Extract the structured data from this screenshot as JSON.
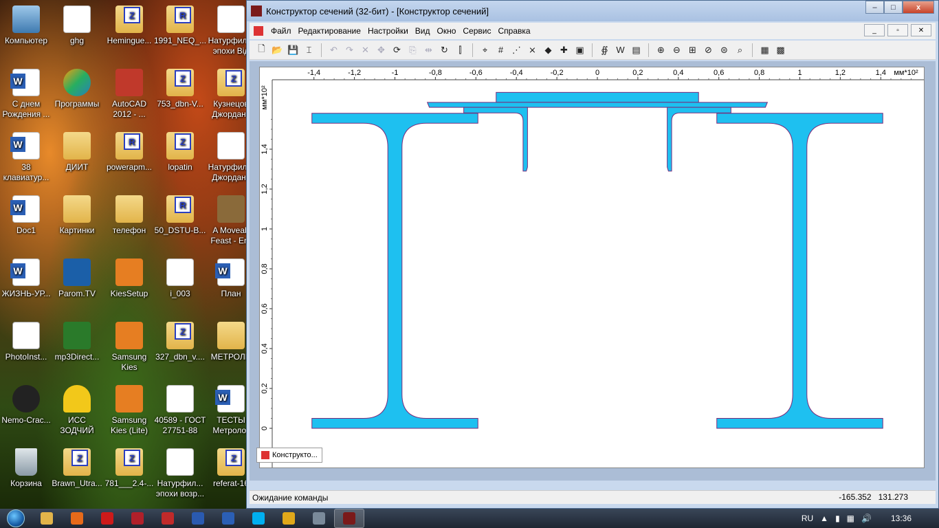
{
  "desktop": {
    "icons": [
      {
        "label": "Компьютер",
        "icon": "computer-icon",
        "type": "computer",
        "col": 0,
        "row": 0
      },
      {
        "label": "ghg",
        "icon": "document-icon",
        "type": "doc",
        "col": 1,
        "row": 0
      },
      {
        "label": "Hemingue...",
        "icon": "archive-icon",
        "type": "folder-z",
        "col": 2,
        "row": 0
      },
      {
        "label": "1991_NEQ_...",
        "icon": "archive-icon",
        "type": "folder-r",
        "col": 3,
        "row": 0
      },
      {
        "label": "Натурфил... эпохи Від",
        "icon": "document-icon",
        "type": "doc",
        "col": 4,
        "row": 0
      },
      {
        "label": "С днем Рождения ...",
        "icon": "word-doc-icon",
        "type": "word",
        "col": 0,
        "row": 1
      },
      {
        "label": "Программы",
        "icon": "msn-icon",
        "type": "msn",
        "col": 1,
        "row": 1
      },
      {
        "label": "AutoCAD 2012 - ...",
        "icon": "autocad-icon",
        "type": "red",
        "col": 2,
        "row": 1
      },
      {
        "label": "753_dbn-V...",
        "icon": "archive-icon",
        "type": "folder-z",
        "col": 3,
        "row": 1
      },
      {
        "label": "Кузнецов Джорданс",
        "icon": "archive-icon",
        "type": "folder-z",
        "col": 4,
        "row": 1
      },
      {
        "label": "38 клавиатур...",
        "icon": "word-doc-icon",
        "type": "word",
        "col": 0,
        "row": 2
      },
      {
        "label": "ДИИТ",
        "icon": "folder-icon",
        "type": "folder",
        "col": 1,
        "row": 2
      },
      {
        "label": "powerapm...",
        "icon": "archive-icon",
        "type": "folder-r",
        "col": 2,
        "row": 2
      },
      {
        "label": "lopatin",
        "icon": "archive-icon",
        "type": "folder-z",
        "col": 3,
        "row": 2
      },
      {
        "label": "Натурфил... Джорданс",
        "icon": "document-icon",
        "type": "doc",
        "col": 4,
        "row": 2
      },
      {
        "label": "Doc1",
        "icon": "word-doc-icon",
        "type": "word",
        "col": 0,
        "row": 3
      },
      {
        "label": "Картинки",
        "icon": "folder-icon",
        "type": "folder",
        "col": 1,
        "row": 3
      },
      {
        "label": "телефон",
        "icon": "folder-icon",
        "type": "folder",
        "col": 2,
        "row": 3
      },
      {
        "label": "50_DSTU-B...",
        "icon": "archive-icon",
        "type": "folder-r",
        "col": 3,
        "row": 3
      },
      {
        "label": "A Moveab Feast - Ern",
        "icon": "book-icon",
        "type": "book",
        "col": 4,
        "row": 3
      },
      {
        "label": "ЖИЗНЬ-УР...",
        "icon": "word-doc-icon",
        "type": "word",
        "col": 0,
        "row": 4
      },
      {
        "label": "Parom.TV",
        "icon": "parom-tv-icon",
        "type": "tv",
        "col": 1,
        "row": 4
      },
      {
        "label": "KiesSetup",
        "icon": "kies-icon",
        "type": "orange",
        "col": 2,
        "row": 4
      },
      {
        "label": "i_003",
        "icon": "document-icon",
        "type": "doc",
        "col": 3,
        "row": 4
      },
      {
        "label": "План",
        "icon": "word-doc-icon",
        "type": "word",
        "col": 4,
        "row": 4
      },
      {
        "label": "PhotoInst...",
        "icon": "photo-icon",
        "type": "photo",
        "col": 0,
        "row": 5
      },
      {
        "label": "mp3Direct...",
        "icon": "mp3-cut-icon",
        "type": "green",
        "col": 1,
        "row": 5
      },
      {
        "label": "Samsung Kies",
        "icon": "kies-icon",
        "type": "orange",
        "col": 2,
        "row": 5
      },
      {
        "label": "327_dbn_v....",
        "icon": "archive-icon",
        "type": "folder-z",
        "col": 3,
        "row": 5
      },
      {
        "label": "МЕТРОЛИ",
        "icon": "folder-icon",
        "type": "folder",
        "col": 4,
        "row": 5
      },
      {
        "label": "Nemo-Crac...",
        "icon": "nemo-icon",
        "type": "nemo",
        "col": 0,
        "row": 6
      },
      {
        "label": "ИСС ЗОДЧИЙ",
        "icon": "hardhat-icon",
        "type": "hat",
        "col": 1,
        "row": 6
      },
      {
        "label": "Samsung Kies (Lite)",
        "icon": "kies-icon",
        "type": "orange",
        "col": 2,
        "row": 6
      },
      {
        "label": "40589 - ГОСТ 27751-88",
        "icon": "document-icon",
        "type": "doc",
        "col": 3,
        "row": 6
      },
      {
        "label": "ТЕСТЫ Метролог",
        "icon": "word-doc-icon",
        "type": "word",
        "col": 4,
        "row": 6
      },
      {
        "label": "Корзина",
        "icon": "recycle-bin-icon",
        "type": "bin",
        "col": 0,
        "row": 7
      },
      {
        "label": "Brawn_Utra...",
        "icon": "archive-icon",
        "type": "folder-z",
        "col": 1,
        "row": 7
      },
      {
        "label": "781___2.4-...",
        "icon": "archive-icon",
        "type": "folder-z",
        "col": 2,
        "row": 7
      },
      {
        "label": "Натурфил... эпохи возр...",
        "icon": "document-icon",
        "type": "doc",
        "col": 3,
        "row": 7
      },
      {
        "label": "referat-16",
        "icon": "archive-icon",
        "type": "folder-z",
        "col": 4,
        "row": 7
      }
    ]
  },
  "window": {
    "title": "Конструктор сечений (32-бит) - [Конструктор сечений]",
    "controls": {
      "minimize": "–",
      "maximize": "□",
      "close": "x"
    }
  },
  "menubar": {
    "items": [
      "Файл",
      "Редактирование",
      "Настройки",
      "Вид",
      "Окно",
      "Сервис",
      "Справка"
    ],
    "mdi": {
      "minimize": "_",
      "restore": "▫",
      "close": "✕"
    }
  },
  "toolbar": {
    "groups": [
      [
        {
          "name": "new-icon",
          "glyph": "🗋",
          "enabled": true
        },
        {
          "name": "open-icon",
          "glyph": "📂",
          "enabled": true
        },
        {
          "name": "save-icon",
          "glyph": "💾",
          "enabled": true
        },
        {
          "name": "properties-icon",
          "glyph": "⌶",
          "enabled": true
        }
      ],
      [
        {
          "name": "undo-icon",
          "glyph": "↶",
          "enabled": false
        },
        {
          "name": "redo-icon",
          "glyph": "↷",
          "enabled": false
        },
        {
          "name": "delete-icon",
          "glyph": "✕",
          "enabled": false
        },
        {
          "name": "move-icon",
          "glyph": "✥",
          "enabled": false
        },
        {
          "name": "rotate-icon",
          "glyph": "⟳",
          "enabled": true
        },
        {
          "name": "copy-icon",
          "glyph": "⎘",
          "enabled": false
        },
        {
          "name": "mirror-icon",
          "glyph": "⇹",
          "enabled": false
        },
        {
          "name": "refresh-icon",
          "glyph": "↻",
          "enabled": true
        },
        {
          "name": "section-icon",
          "glyph": "⫿",
          "enabled": true
        }
      ],
      [
        {
          "name": "snap-icon",
          "glyph": "⌖",
          "enabled": true
        },
        {
          "name": "grid-icon",
          "glyph": "#",
          "enabled": true
        },
        {
          "name": "nodes-icon",
          "glyph": "⋰",
          "enabled": true
        },
        {
          "name": "cross-icon",
          "glyph": "⨯",
          "enabled": true
        },
        {
          "name": "point-icon",
          "glyph": "◆",
          "enabled": true
        },
        {
          "name": "plus-icon",
          "glyph": "✚",
          "enabled": true
        },
        {
          "name": "calc-icon",
          "glyph": "▣",
          "enabled": true
        }
      ],
      [
        {
          "name": "stress-icon",
          "glyph": "∯",
          "enabled": true
        },
        {
          "name": "w-icon",
          "glyph": "W",
          "enabled": true
        },
        {
          "name": "palette-icon",
          "glyph": "▤",
          "enabled": true
        }
      ],
      [
        {
          "name": "zoom-in-icon",
          "glyph": "⊕",
          "enabled": true
        },
        {
          "name": "zoom-out-icon",
          "glyph": "⊖",
          "enabled": true
        },
        {
          "name": "zoom-window-icon",
          "glyph": "⊞",
          "enabled": true
        },
        {
          "name": "zoom-prev-icon",
          "glyph": "⊘",
          "enabled": true
        },
        {
          "name": "zoom-fit-icon",
          "glyph": "⊜",
          "enabled": true
        },
        {
          "name": "zoom-all-icon",
          "glyph": "⌕",
          "enabled": true
        }
      ],
      [
        {
          "name": "layout-icon",
          "glyph": "▦",
          "enabled": true
        },
        {
          "name": "report-icon",
          "glyph": "▩",
          "enabled": true
        }
      ]
    ]
  },
  "drawing": {
    "unit_label": "мм*10²",
    "x_ticks": [
      "-1,4",
      "-1,2",
      "-1",
      "-0,8",
      "-0,6",
      "-0,4",
      "-0,2",
      "0",
      "0,2",
      "0,4",
      "0,6",
      "0,8",
      "1",
      "1,2",
      "1,4"
    ],
    "y_ticks": [
      "0",
      "0,2",
      "0,4",
      "0,6",
      "0,8",
      "1",
      "1,2",
      "1,4"
    ],
    "x_range": [
      -1.4,
      1.4
    ],
    "y_range": [
      0,
      1.6
    ],
    "fill_color": "#1ec0f0",
    "stroke_color": "#7a2a7a"
  },
  "tab": {
    "label": "Конструкто..."
  },
  "statusbar": {
    "message": "Ожидание команды",
    "x": "-165.352",
    "y": "131.273"
  },
  "taskbar": {
    "apps": [
      {
        "name": "explorer-icon",
        "color": "#e2b44a"
      },
      {
        "name": "firefox-icon",
        "color": "#e66a1a"
      },
      {
        "name": "opera-icon",
        "color": "#cc1a1a"
      },
      {
        "name": "autocad-icon",
        "color": "#b0202a"
      },
      {
        "name": "section-builder-icon",
        "color": "#c02a2a"
      },
      {
        "name": "ukraine-emblem-icon",
        "color": "#2a5ab0"
      },
      {
        "name": "word-icon",
        "color": "#2b5fb5"
      },
      {
        "name": "skype-icon",
        "color": "#00aff0"
      },
      {
        "name": "warning-icon",
        "color": "#e0a81a"
      },
      {
        "name": "network-icon",
        "color": "#7a8a9a"
      },
      {
        "name": "section-builder-active-icon",
        "color": "#7a1a1a"
      }
    ],
    "lang": "RU",
    "clock": "13:36"
  }
}
